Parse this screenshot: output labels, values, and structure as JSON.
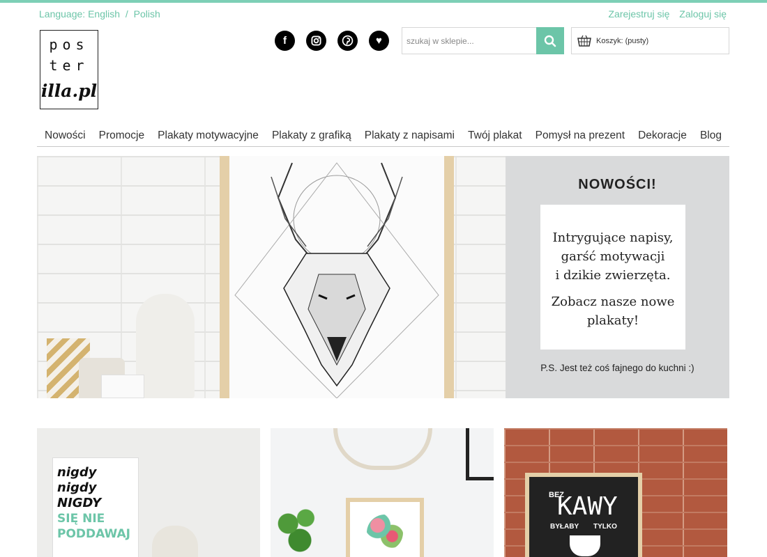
{
  "header": {
    "language_label": "Language:",
    "languages": [
      "English",
      "Polish"
    ],
    "language_separator": "/",
    "register_label": "Zarejestruj się",
    "login_label": "Zaloguj się"
  },
  "logo": {
    "line1": "pos",
    "line2": "ter",
    "line3": "illa.pl"
  },
  "social": [
    {
      "icon": "facebook-icon",
      "glyph": "f"
    },
    {
      "icon": "instagram-icon",
      "glyph": "◘"
    },
    {
      "icon": "pinterest-icon",
      "glyph": "ⓟ"
    },
    {
      "icon": "heart-icon",
      "glyph": "♥"
    }
  ],
  "search": {
    "placeholder": "szukaj w sklepie...",
    "value": ""
  },
  "cart": {
    "label": "Koszyk: (pusty)"
  },
  "menu": [
    "Nowości",
    "Promocje",
    "Plakaty motywacyjne",
    "Plakaty z grafiką",
    "Plakaty z napisami",
    "Twój plakat",
    "Pomysł na prezent",
    "Dekoracje",
    "Blog"
  ],
  "banner": {
    "heading": "NOWOŚCI!",
    "text1": [
      "Intrygujące napisy,",
      "garść motywacji",
      "i dzikie zwierzęta."
    ],
    "text2": [
      "Zobacz nasze nowe",
      "plakaty!"
    ],
    "ps": "P.S. Jest też coś fajnego do kuchni :)"
  },
  "products": {
    "p1": {
      "lines": [
        "nigdy",
        "nigdy",
        "NIGDY",
        "SIĘ NIE",
        "PODDAWAJ"
      ]
    },
    "p3": {
      "bez": "BEZ",
      "kawy": "KAWY",
      "bylaby": "BYŁABY",
      "tylko": "TYLKO"
    }
  },
  "colors": {
    "accent": "#6cc5a8",
    "text": "#333333"
  }
}
